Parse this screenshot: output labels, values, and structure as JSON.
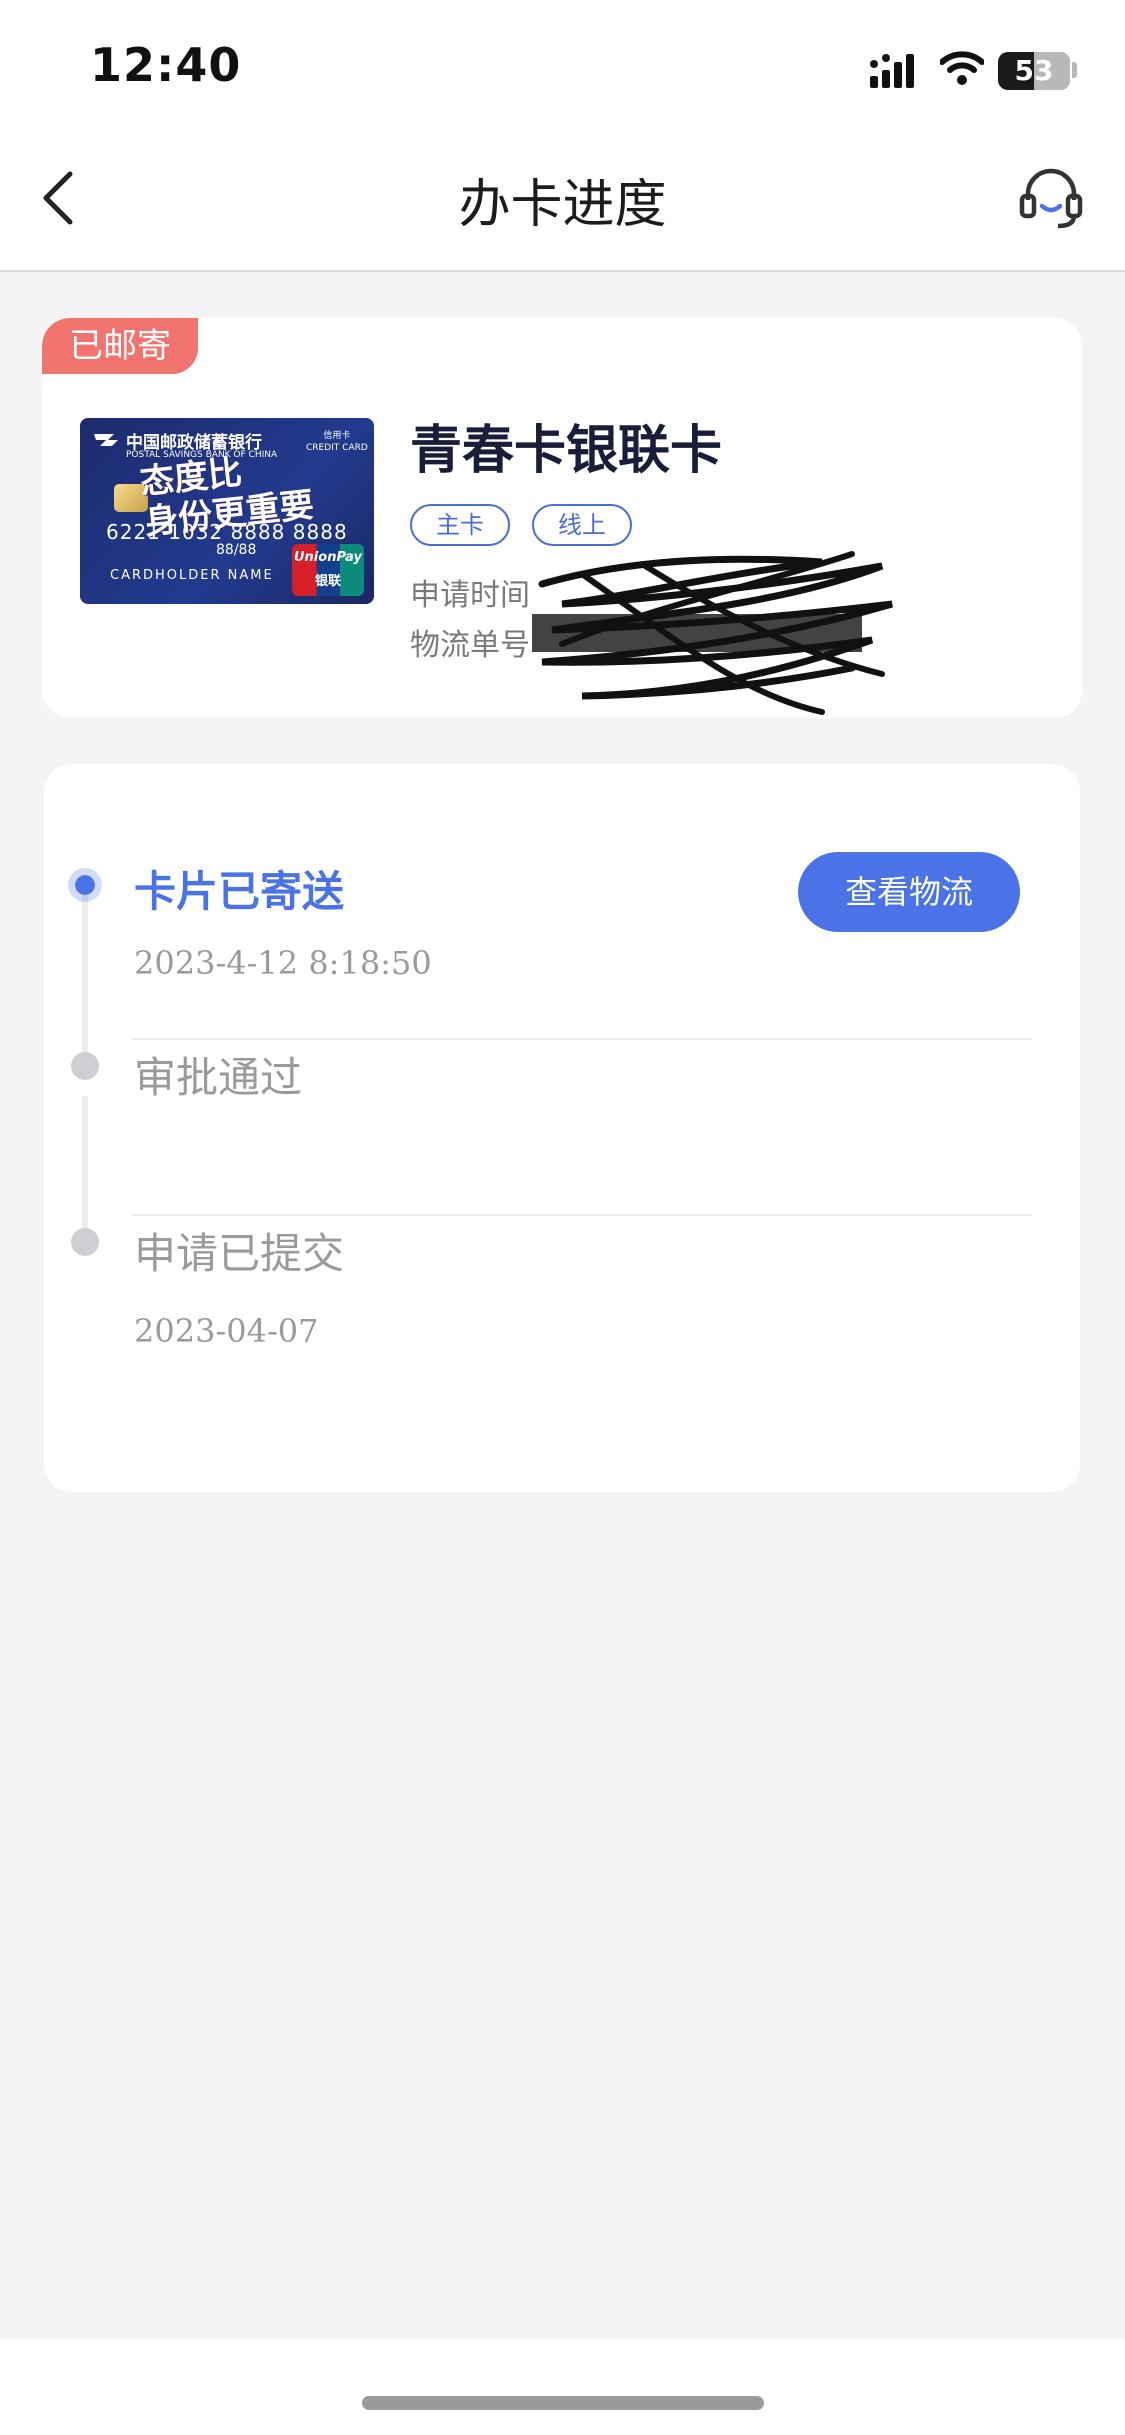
{
  "status_bar": {
    "time": "12:40",
    "battery": "53"
  },
  "nav": {
    "title": "办卡进度",
    "back_icon": "chevron-left-icon",
    "service_icon": "headset-icon"
  },
  "card_info": {
    "badge": "已邮寄",
    "card_name": "青春卡银联卡",
    "tags": [
      "主卡",
      "线上"
    ],
    "apply_time_label": "申请时间",
    "tracking_label": "物流单号",
    "card_image": {
      "bank_name": "中国邮政储蓄银行",
      "bank_name_en": "POSTAL SAVINGS BANK OF CHINA",
      "credit_label": "信用卡",
      "credit_label_en": "CREDIT CARD",
      "slogan": [
        "态度比",
        "身份更重要"
      ],
      "number": "6221 1032 8888 8888",
      "valid": "88/88",
      "holder": "CARDHOLDER NAME",
      "union_en": "UnionPay",
      "union_cn": "银联"
    }
  },
  "progress": {
    "steps": [
      {
        "title": "卡片已寄送",
        "time": "2023-4-12 8:18:50",
        "active": true
      },
      {
        "title": "审批通过",
        "time": "",
        "active": false
      },
      {
        "title": "申请已提交",
        "time": "2023-04-07",
        "active": false
      }
    ],
    "logistics_button": "查看物流"
  },
  "colors": {
    "accent": "#4a73e8",
    "badge": "#f0736e",
    "background": "#f4f4f6"
  }
}
